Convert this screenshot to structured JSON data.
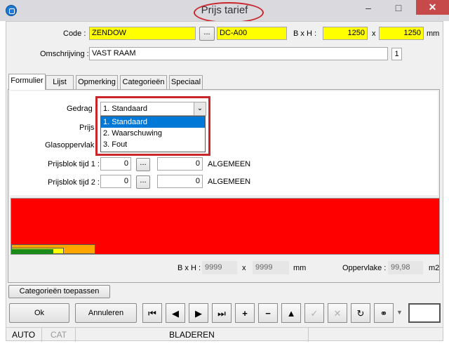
{
  "window": {
    "title": "Prijs tarief",
    "minimize": "–",
    "maximize": "□",
    "close": "✕"
  },
  "header": {
    "code_label": "Code :",
    "code_value": "ZENDOW",
    "browse": "...",
    "code2_value": "DC-A00",
    "bxh_label": "B x H :",
    "width_value": "1250",
    "x_sep": "x",
    "height_value": "1250",
    "unit": "mm",
    "omschrijving_label": "Omschrijving :",
    "omschrijving_value": "VAST RAAM",
    "omschrijving_count": "1"
  },
  "tabs": [
    "Formulier",
    "Lijst",
    "Opmerking",
    "Categorieën",
    "Speciaal"
  ],
  "form": {
    "gedrag_label": "Gedrag",
    "gedrag_value": "1.  Standaard",
    "prijs_label": "Prijs",
    "glas_label": "Glasoppervlak",
    "dropdown_options": [
      "1.  Standaard",
      "2.  Waarschuwing",
      "3.  Fout"
    ],
    "pb1_label": "Prijsblok tijd 1 :",
    "pb1_value": "0",
    "pb1_value2": "0",
    "pb1_text": "ALGEMEEN",
    "pb2_label": "Prijsblok tijd 2 :",
    "pb2_value": "0",
    "pb2_value2": "0",
    "pb2_text": "ALGEMEEN"
  },
  "bottom_info": {
    "bxh_label": "B x H :",
    "b_value": "9999",
    "x_sep": "x",
    "h_value": "9999",
    "mm": "mm",
    "opp_label": "Oppervlake :",
    "opp_value": "99,98",
    "m2": "m2"
  },
  "buttons": {
    "categorieen": "Categorieën toepassen",
    "ok": "Ok",
    "annuleren": "Annuleren"
  },
  "status": {
    "auto": "AUTO",
    "cat": "CAT",
    "bladeren": "BLADEREN"
  },
  "colors": {
    "accent_red": "#c9262b",
    "highlight_yellow": "#ffff00",
    "selection_blue": "#0078d7"
  }
}
